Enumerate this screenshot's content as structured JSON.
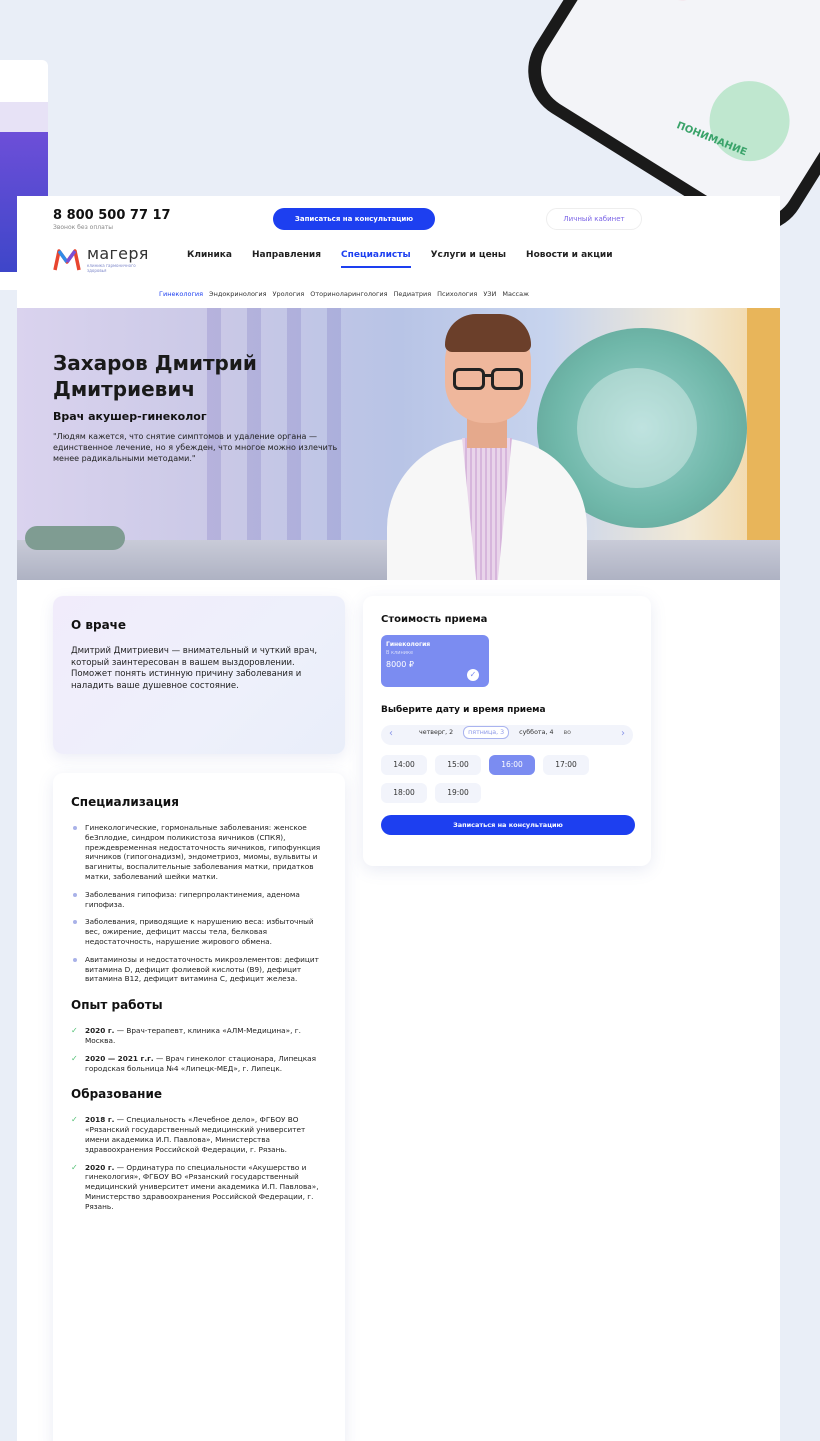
{
  "header": {
    "phone": "8 800 500 77 17",
    "phone_note": "Звонок без оплаты",
    "book_button": "Записаться на консультацию",
    "cabinet_button": "Личный кабинет"
  },
  "logo": {
    "name": "магеря",
    "tagline": "клиника гармоничного здоровья"
  },
  "nav": {
    "items": [
      "Клиника",
      "Направления",
      "Специалисты",
      "Услуги и цены",
      "Новости и акции"
    ],
    "active": "Специалисты"
  },
  "subnav": {
    "items": [
      "Гинекология",
      "Эндокринология",
      "Урология",
      "Оториноларингология",
      "Педиатрия",
      "Психология",
      "УЗИ",
      "Массаж"
    ],
    "active": "Гинекология"
  },
  "hero": {
    "name": "Захаров Дмитрий Дмитриевич",
    "role": "Врач акушер-гинеколог",
    "quote": "\"Людям кажется, что снятие симптомов и удаление органа — единственное лечение, но я убежден, что многое можно излечить менее радикальными методами.\""
  },
  "about": {
    "title": "О враче",
    "text": "Дмитрий Дмитриевич — внимательный и чуткий врач, который заинтересован в вашем выздоровлении. Поможет понять истинную причину заболевания и наладить ваше душевное состояние."
  },
  "specialization": {
    "title": "Специализация",
    "items": [
      "Гинекологические, гормональные заболевания: женское беЗплодие, синдром поликистоза яичников (СПКЯ), преждевременная недостаточность яичников, гипофункция яичников (гипогонадизм), эндометриоз, миомы, вульвиты и вагиниты, воспалительные заболевания матки, придатков матки, заболеваний шейки матки.",
      "Заболевания гипофиза: гиперпролактинемия, аденома гипофиза.",
      "Заболевания, приводящие к нарушению веса: избыточный вес, ожирение, дефицит массы тела, белковая недостаточность, нарушение жирового обмена.",
      "Авитаминозы и недостаточность микроэлементов: дефицит витамина D, дефицит фолиевой кислоты (B9), дефицит витамина B12, дефицит витамина С, дефицит железа."
    ]
  },
  "experience": {
    "title": "Опыт работы",
    "items": [
      {
        "year": "2020 г.",
        "text": " — Врач-терапевт, клиника «АЛМ-Медицина», г. Москва."
      },
      {
        "year": "2020 — 2021 г.г.",
        "text": " — Врач гинеколог стационара, Липецкая городская больница №4 «Липецк-МЕД», г. Липецк."
      }
    ]
  },
  "education": {
    "title": "Образование",
    "items": [
      {
        "year": "2018 г.",
        "text": " — Специальность «Лечебное дело», ФГБОУ ВО «Рязанский государственный медицинский университет имени академика И.П. Павлова», Министерства здравоохранения Российской Федерации, г. Рязань."
      },
      {
        "year": "2020 г.",
        "text": " — Ординатура по специальности «Акушерство и гинекология», ФГБОУ ВО «Рязанский государственный медицинский университет имени академика И.П. Павлова», Министерство здравоохранения Российской Федерации, г. Рязань."
      }
    ]
  },
  "price": {
    "title": "Стоимость приема",
    "service": "Гинекология",
    "location": "В клинике",
    "amount": "8000 ₽"
  },
  "booking": {
    "title": "Выберите дату и время приема",
    "days": [
      "четверг, 2",
      "пятница, 3",
      "суббота, 4",
      "во"
    ],
    "selected_day": "пятница, 3",
    "slots": [
      "14:00",
      "15:00",
      "16:00",
      "17:00",
      "18:00",
      "19:00"
    ],
    "selected_slot": "16:00",
    "button": "Записаться на консультацию"
  },
  "background": {
    "phone_label": "ПОНИМАНИЕ"
  },
  "colors": {
    "accent": "#1d3ff0",
    "tile": "#7b8cf1",
    "check": "#4fbf72"
  }
}
